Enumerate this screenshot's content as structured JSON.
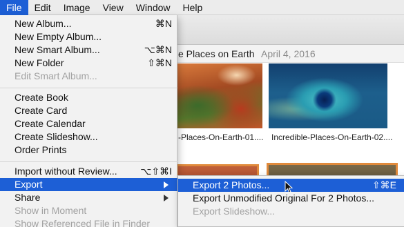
{
  "menubar": {
    "items": [
      "File",
      "Edit",
      "Image",
      "View",
      "Window",
      "Help"
    ],
    "active": "File"
  },
  "album": {
    "title": "e Places on Earth",
    "date": "April 4, 2016"
  },
  "photos": [
    {
      "caption": "-Places-On-Earth-01...."
    },
    {
      "caption": "Incredible-Places-On-Earth-02...."
    }
  ],
  "file_menu": {
    "items": [
      {
        "label": "New Album...",
        "shortcut": "⌘N",
        "enabled": true
      },
      {
        "label": "New Empty Album...",
        "shortcut": "",
        "enabled": true
      },
      {
        "label": "New Smart Album...",
        "shortcut": "⌥⌘N",
        "enabled": true
      },
      {
        "label": "New Folder",
        "shortcut": "⇧⌘N",
        "enabled": true
      },
      {
        "label": "Edit Smart Album...",
        "shortcut": "",
        "enabled": false
      },
      {
        "label": "Create Book",
        "shortcut": "",
        "enabled": true
      },
      {
        "label": "Create Card",
        "shortcut": "",
        "enabled": true
      },
      {
        "label": "Create Calendar",
        "shortcut": "",
        "enabled": true
      },
      {
        "label": "Create Slideshow...",
        "shortcut": "",
        "enabled": true
      },
      {
        "label": "Order Prints",
        "shortcut": "",
        "enabled": true
      },
      {
        "label": "Import without Review...",
        "shortcut": "⌥⇧⌘I",
        "enabled": true
      },
      {
        "label": "Export",
        "shortcut": "",
        "enabled": true,
        "highlighted": true,
        "submenu": true
      },
      {
        "label": "Share",
        "shortcut": "",
        "enabled": true,
        "submenu": true
      },
      {
        "label": "Show in Moment",
        "shortcut": "",
        "enabled": false
      },
      {
        "label": "Show Referenced File in Finder",
        "shortcut": "",
        "enabled": false
      }
    ]
  },
  "export_submenu": {
    "items": [
      {
        "label": "Export 2 Photos...",
        "shortcut": "⇧⌘E",
        "enabled": true,
        "highlighted": true
      },
      {
        "label": "Export Unmodified Original For 2 Photos...",
        "shortcut": "",
        "enabled": true
      },
      {
        "label": "Export Slideshow...",
        "shortcut": "",
        "enabled": false
      }
    ]
  },
  "colors": {
    "highlight": "#1d5fd6",
    "menu_bg": "#f2f2f2",
    "disabled_text": "#a2a2a2",
    "selection_border": "#e08a3c"
  }
}
